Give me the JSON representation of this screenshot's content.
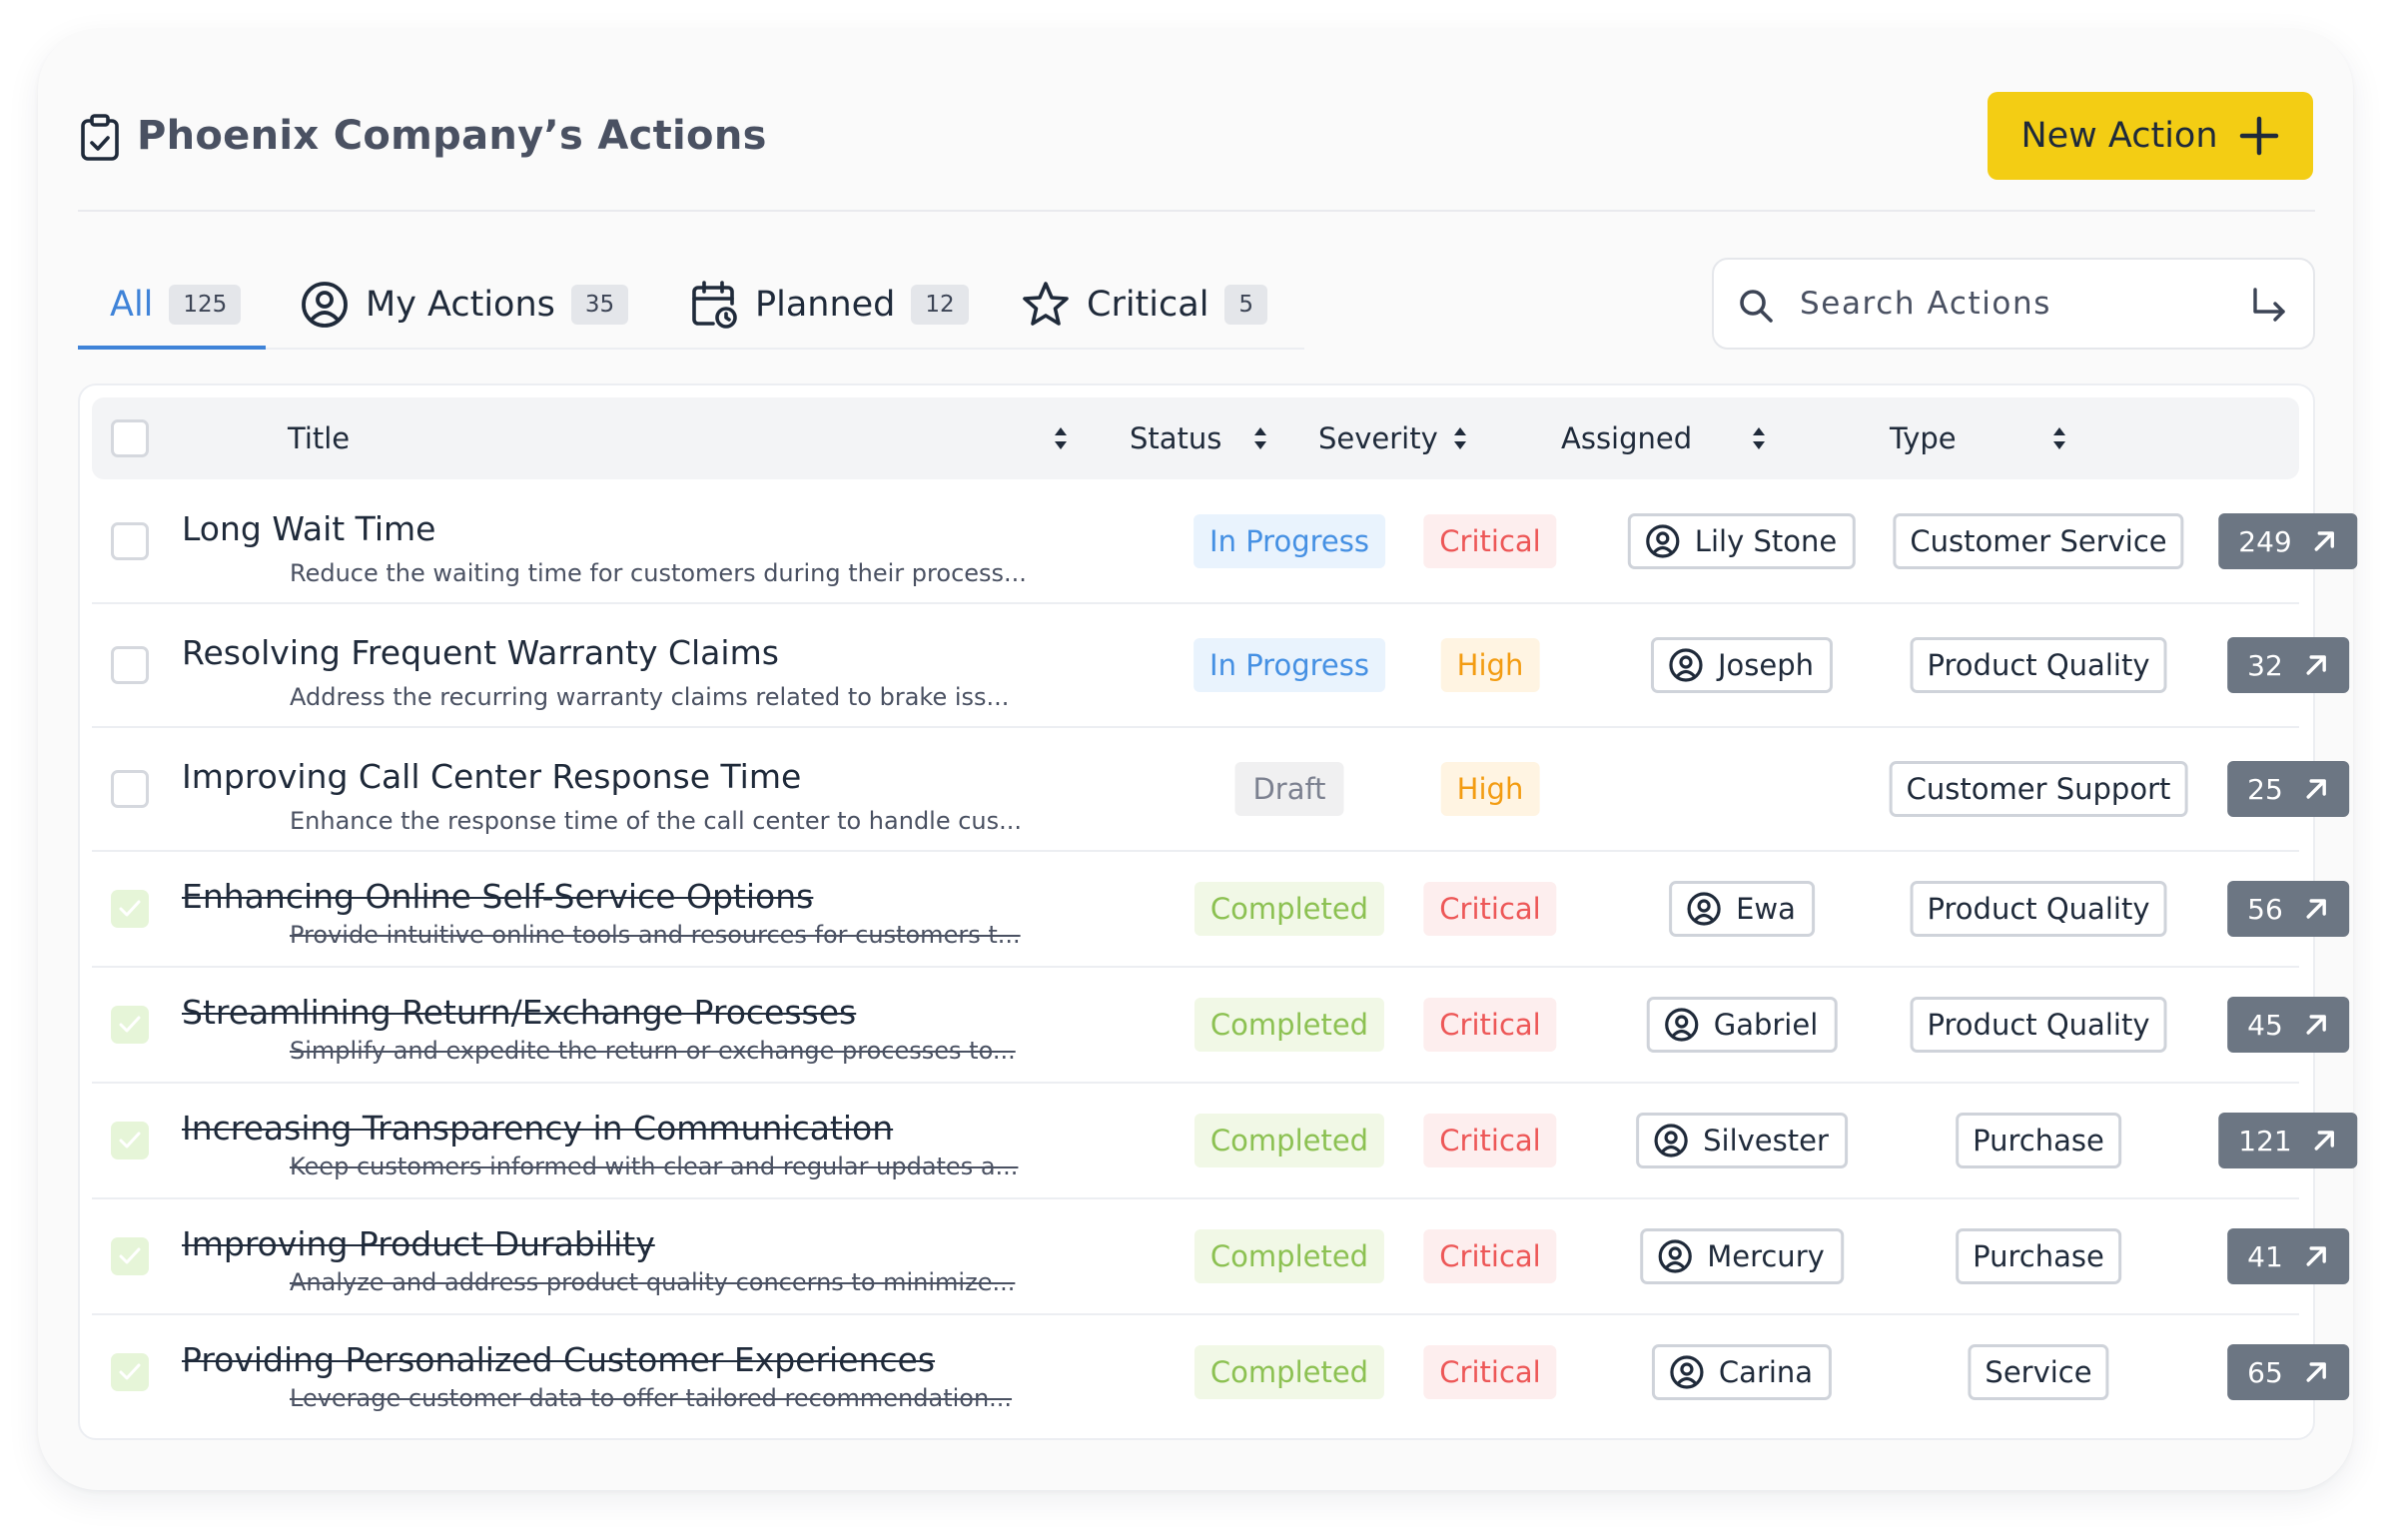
{
  "header": {
    "title": "Phoenix Company’s Actions",
    "new_action_label": "New Action"
  },
  "tabs": [
    {
      "label": "All",
      "count": "125",
      "icon": "none"
    },
    {
      "label": "My Actions",
      "count": "35",
      "icon": "user-circle-icon"
    },
    {
      "label": "Planned",
      "count": "12",
      "icon": "calendar-clock-icon"
    },
    {
      "label": "Critical",
      "count": "5",
      "icon": "star-icon"
    }
  ],
  "search": {
    "placeholder": "Search Actions"
  },
  "table": {
    "headers": {
      "title": "Title",
      "status": "Status",
      "severity": "Severity",
      "assigned": "Assigned",
      "type": "Type"
    },
    "rows": [
      {
        "title": "Long Wait Time",
        "desc": "Reduce the waiting time for customers during their process...",
        "status": "In Progress",
        "severity": "Critical",
        "assigned": "Lily Stone",
        "type": "Customer Service",
        "count": "249",
        "checked": false
      },
      {
        "title": "Resolving Frequent Warranty Claims",
        "desc": "Address the recurring warranty claims related to brake iss...",
        "status": "In Progress",
        "severity": "High",
        "assigned": "Joseph",
        "type": "Product Quality",
        "count": "32",
        "checked": false
      },
      {
        "title": "Improving Call Center Response Time",
        "desc": "Enhance the response time of the call center to handle cus...",
        "status": "Draft",
        "severity": "High",
        "assigned": "",
        "type": "Customer Support",
        "count": "25",
        "checked": false
      },
      {
        "title": "Enhancing Online Self-Service Options",
        "desc": "Provide intuitive online tools and resources for customers t...",
        "status": "Completed",
        "severity": "Critical",
        "assigned": "Ewa",
        "type": "Product Quality",
        "count": "56",
        "checked": true
      },
      {
        "title": "Streamlining Return/Exchange Processes",
        "desc": "Simplify and expedite the return or exchange processes to...",
        "status": "Completed",
        "severity": "Critical",
        "assigned": "Gabriel",
        "type": "Product Quality",
        "count": "45",
        "checked": true
      },
      {
        "title": "Increasing Transparency in Communication",
        "desc": "Keep customers informed with clear and regular updates a...",
        "status": "Completed",
        "severity": "Critical",
        "assigned": "Silvester",
        "type": "Purchase",
        "count": "121",
        "checked": true
      },
      {
        "title": "Improving Product Durability",
        "desc": "Analyze and address product quality concerns to minimize...",
        "status": "Completed",
        "severity": "Critical",
        "assigned": "Mercury",
        "type": "Purchase",
        "count": "41",
        "checked": true
      },
      {
        "title": "Providing Personalized Customer Experiences",
        "desc": "Leverage customer data to offer tailored recommendation...",
        "status": "Completed",
        "severity": "Critical",
        "assigned": "Carina",
        "type": "Service",
        "count": "65",
        "checked": true
      }
    ]
  },
  "colors": {
    "accent": "#3f83d8",
    "primary_button": "#f3cd14",
    "status_in_progress": "#4590e3",
    "status_completed": "#8cc152",
    "status_draft": "#7c8190",
    "severity_critical": "#ed5757",
    "severity_high": "#f39c12"
  }
}
